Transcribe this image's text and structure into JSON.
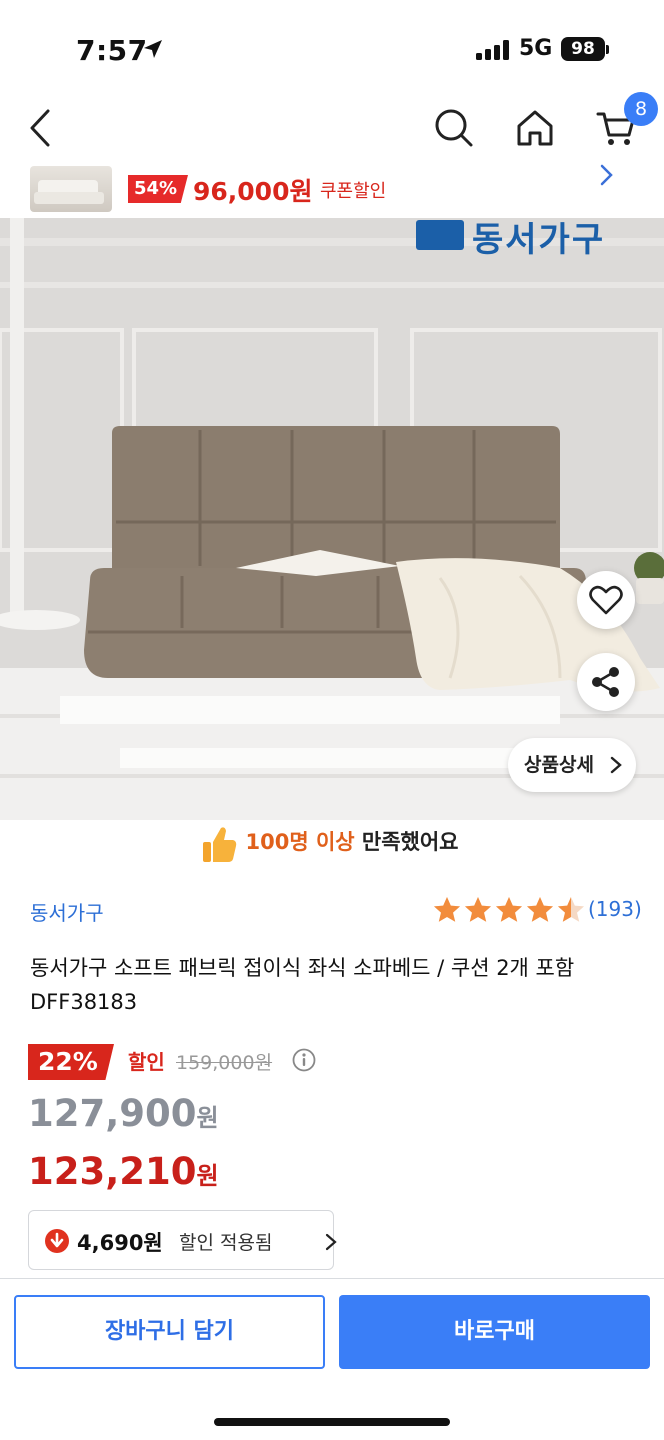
{
  "status_bar": {
    "time": "7:57",
    "network": "5G",
    "battery": "98"
  },
  "nav": {
    "cart_count": "8",
    "icons": [
      "back-icon",
      "search-icon",
      "home-icon",
      "cart-icon"
    ]
  },
  "option_strip": {
    "discount": "54%",
    "price": "96,000원",
    "coupon_label": "쿠폰할인"
  },
  "hero": {
    "brand_logo_text": "동서가구",
    "detail_button": "상품상세",
    "colors": {
      "wall": "#dedcda",
      "sofa": "#8b7d6e",
      "floor": "#f0efee"
    }
  },
  "satisfaction": {
    "highlight": "100명 이상",
    "rest": " 만족했어요"
  },
  "product": {
    "brand": "동서가구",
    "rating_value": 4.5,
    "rating_count": "(193)",
    "title": "동서가구 소프트 패브릭 접이식 좌식 소파베드 / 쿠션 2개 포함 DFF38183"
  },
  "pricing": {
    "discount_pct": "22%",
    "sale_label": "할인",
    "original_price": "159,000원",
    "sale_price": "127,900",
    "final_price": "123,210",
    "unit": "원",
    "extra_discount_amount": "4,690원",
    "extra_discount_label": "할인 적용됨"
  },
  "actions": {
    "add_to_cart": "장바구니 담기",
    "buy_now": "바로구매"
  },
  "colors": {
    "accent_blue": "#3a7ef7",
    "price_red": "#c8201a",
    "link_blue": "#2d6fd6",
    "star_orange": "#f28c3c"
  }
}
